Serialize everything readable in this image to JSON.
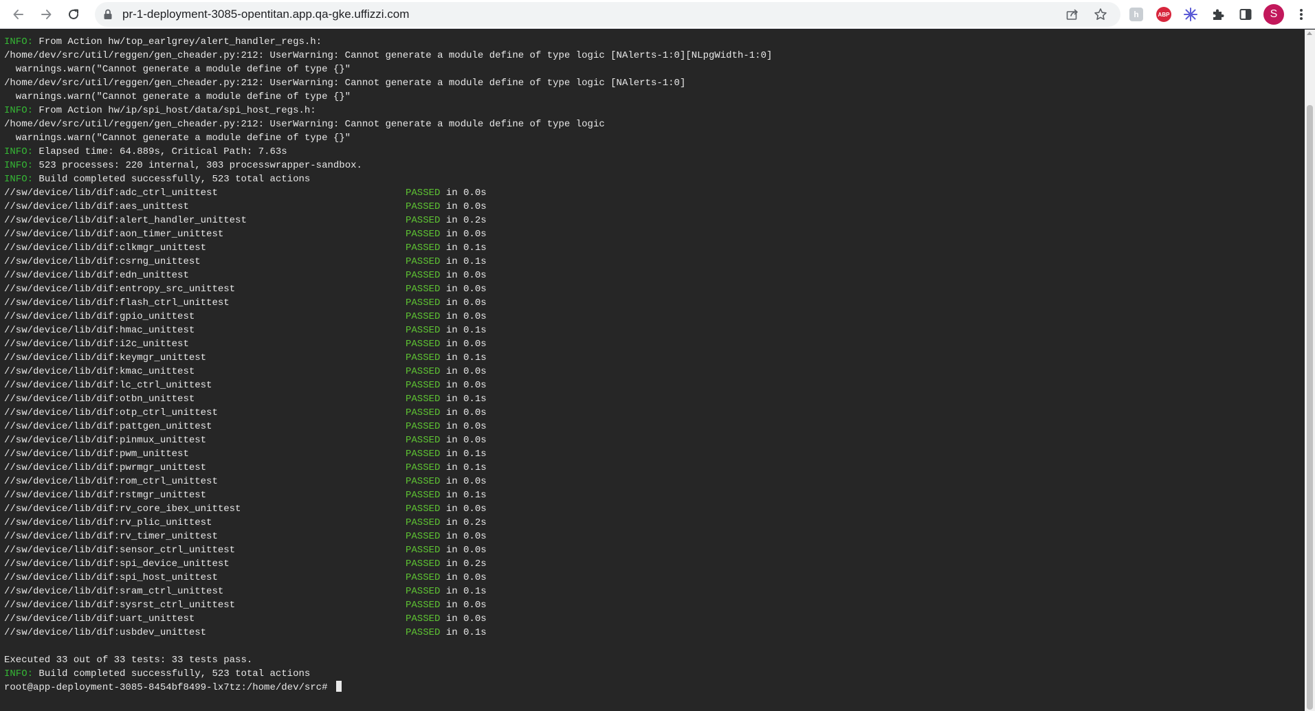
{
  "browser": {
    "url": "pr-1-deployment-3085-opentitan.app.qa-gke.uffizzi.com",
    "profile_initial": "S",
    "abp_label": "ABP",
    "ext_letter": "h"
  },
  "colors": {
    "terminal_bg": "#262626",
    "terminal_text": "#e8e8e8",
    "info_green": "#35b835",
    "passed_green": "#5ec433"
  },
  "terminal": {
    "header_lines": [
      {
        "tag": "INFO:",
        "text": " From Action hw/top_earlgrey/alert_handler_regs.h:"
      },
      {
        "tag": "",
        "text": "/home/dev/src/util/reggen/gen_cheader.py:212: UserWarning: Cannot generate a module define of type logic [NAlerts-1:0][NLpgWidth-1:0]"
      },
      {
        "tag": "",
        "text": "  warnings.warn(\"Cannot generate a module define of type {}\""
      },
      {
        "tag": "",
        "text": "/home/dev/src/util/reggen/gen_cheader.py:212: UserWarning: Cannot generate a module define of type logic [NAlerts-1:0]"
      },
      {
        "tag": "",
        "text": "  warnings.warn(\"Cannot generate a module define of type {}\""
      },
      {
        "tag": "INFO:",
        "text": " From Action hw/ip/spi_host/data/spi_host_regs.h:"
      },
      {
        "tag": "",
        "text": "/home/dev/src/util/reggen/gen_cheader.py:212: UserWarning: Cannot generate a module define of type logic"
      },
      {
        "tag": "",
        "text": "  warnings.warn(\"Cannot generate a module define of type {}\""
      },
      {
        "tag": "INFO:",
        "text": " Elapsed time: 64.889s, Critical Path: 7.63s"
      },
      {
        "tag": "INFO:",
        "text": " 523 processes: 220 internal, 303 processwrapper-sandbox."
      },
      {
        "tag": "INFO:",
        "text": " Build completed successfully, 523 total actions"
      }
    ],
    "tests": [
      {
        "name": "//sw/device/lib/dif:adc_ctrl_unittest",
        "status": "PASSED",
        "time": " in 0.0s"
      },
      {
        "name": "//sw/device/lib/dif:aes_unittest",
        "status": "PASSED",
        "time": " in 0.0s"
      },
      {
        "name": "//sw/device/lib/dif:alert_handler_unittest",
        "status": "PASSED",
        "time": " in 0.2s"
      },
      {
        "name": "//sw/device/lib/dif:aon_timer_unittest",
        "status": "PASSED",
        "time": " in 0.0s"
      },
      {
        "name": "//sw/device/lib/dif:clkmgr_unittest",
        "status": "PASSED",
        "time": " in 0.1s"
      },
      {
        "name": "//sw/device/lib/dif:csrng_unittest",
        "status": "PASSED",
        "time": " in 0.1s"
      },
      {
        "name": "//sw/device/lib/dif:edn_unittest",
        "status": "PASSED",
        "time": " in 0.0s"
      },
      {
        "name": "//sw/device/lib/dif:entropy_src_unittest",
        "status": "PASSED",
        "time": " in 0.0s"
      },
      {
        "name": "//sw/device/lib/dif:flash_ctrl_unittest",
        "status": "PASSED",
        "time": " in 0.0s"
      },
      {
        "name": "//sw/device/lib/dif:gpio_unittest",
        "status": "PASSED",
        "time": " in 0.0s"
      },
      {
        "name": "//sw/device/lib/dif:hmac_unittest",
        "status": "PASSED",
        "time": " in 0.1s"
      },
      {
        "name": "//sw/device/lib/dif:i2c_unittest",
        "status": "PASSED",
        "time": " in 0.0s"
      },
      {
        "name": "//sw/device/lib/dif:keymgr_unittest",
        "status": "PASSED",
        "time": " in 0.1s"
      },
      {
        "name": "//sw/device/lib/dif:kmac_unittest",
        "status": "PASSED",
        "time": " in 0.0s"
      },
      {
        "name": "//sw/device/lib/dif:lc_ctrl_unittest",
        "status": "PASSED",
        "time": " in 0.0s"
      },
      {
        "name": "//sw/device/lib/dif:otbn_unittest",
        "status": "PASSED",
        "time": " in 0.1s"
      },
      {
        "name": "//sw/device/lib/dif:otp_ctrl_unittest",
        "status": "PASSED",
        "time": " in 0.0s"
      },
      {
        "name": "//sw/device/lib/dif:pattgen_unittest",
        "status": "PASSED",
        "time": " in 0.0s"
      },
      {
        "name": "//sw/device/lib/dif:pinmux_unittest",
        "status": "PASSED",
        "time": " in 0.0s"
      },
      {
        "name": "//sw/device/lib/dif:pwm_unittest",
        "status": "PASSED",
        "time": " in 0.1s"
      },
      {
        "name": "//sw/device/lib/dif:pwrmgr_unittest",
        "status": "PASSED",
        "time": " in 0.1s"
      },
      {
        "name": "//sw/device/lib/dif:rom_ctrl_unittest",
        "status": "PASSED",
        "time": " in 0.0s"
      },
      {
        "name": "//sw/device/lib/dif:rstmgr_unittest",
        "status": "PASSED",
        "time": " in 0.1s"
      },
      {
        "name": "//sw/device/lib/dif:rv_core_ibex_unittest",
        "status": "PASSED",
        "time": " in 0.0s"
      },
      {
        "name": "//sw/device/lib/dif:rv_plic_unittest",
        "status": "PASSED",
        "time": " in 0.2s"
      },
      {
        "name": "//sw/device/lib/dif:rv_timer_unittest",
        "status": "PASSED",
        "time": " in 0.0s"
      },
      {
        "name": "//sw/device/lib/dif:sensor_ctrl_unittest",
        "status": "PASSED",
        "time": " in 0.0s"
      },
      {
        "name": "//sw/device/lib/dif:spi_device_unittest",
        "status": "PASSED",
        "time": " in 0.2s"
      },
      {
        "name": "//sw/device/lib/dif:spi_host_unittest",
        "status": "PASSED",
        "time": " in 0.0s"
      },
      {
        "name": "//sw/device/lib/dif:sram_ctrl_unittest",
        "status": "PASSED",
        "time": " in 0.1s"
      },
      {
        "name": "//sw/device/lib/dif:sysrst_ctrl_unittest",
        "status": "PASSED",
        "time": " in 0.0s"
      },
      {
        "name": "//sw/device/lib/dif:uart_unittest",
        "status": "PASSED",
        "time": " in 0.0s"
      },
      {
        "name": "//sw/device/lib/dif:usbdev_unittest",
        "status": "PASSED",
        "time": " in 0.1s"
      }
    ],
    "summary": "Executed 33 out of 33 tests: 33 tests pass.",
    "final_info": {
      "tag": "INFO:",
      "text": " Build completed successfully, 523 total actions"
    },
    "prompt": "root@app-deployment-3085-8454bf8499-lx7tz:/home/dev/src# "
  }
}
